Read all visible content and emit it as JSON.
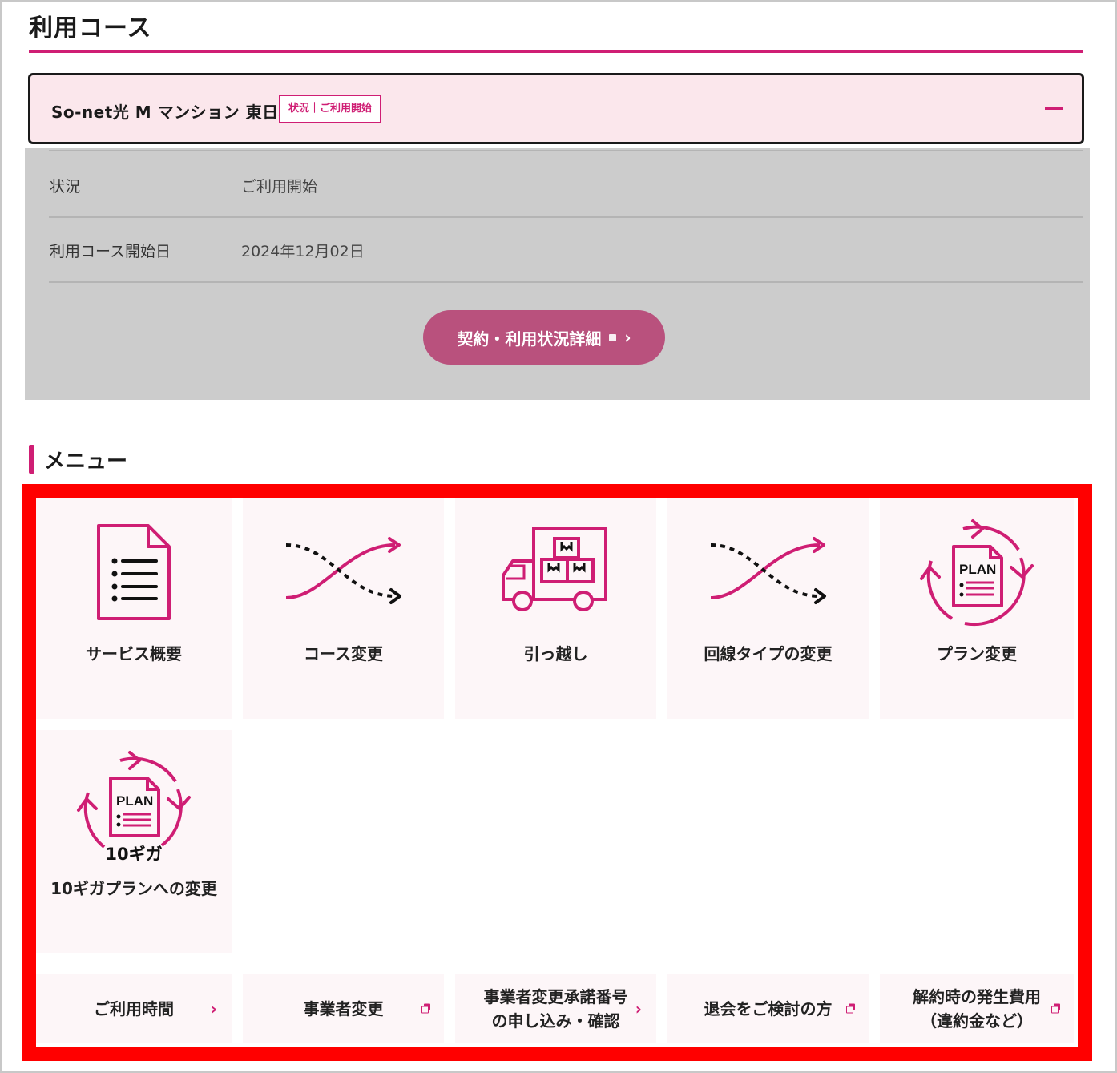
{
  "page_title": "利用コース",
  "course": {
    "name": "So-net光 M マンション 東日本",
    "status_badge": "状況｜ご利用開始",
    "details": [
      {
        "label": "状況",
        "value": "ご利用開始"
      },
      {
        "label": "利用コース開始日",
        "value": "2024年12月02日"
      }
    ],
    "detail_button": "契約・利用状況詳細",
    "detail_button_chevron": "›"
  },
  "menu": {
    "title": "メニュー",
    "tiles": [
      {
        "label": "サービス概要",
        "icon": "document-list-icon"
      },
      {
        "label": "コース変更",
        "icon": "crossing-arrows-icon"
      },
      {
        "label": "引っ越し",
        "icon": "moving-truck-icon"
      },
      {
        "label": "回線タイプの変更",
        "icon": "crossing-arrows-icon"
      },
      {
        "label": "プラン変更",
        "icon": "plan-cycle-icon",
        "icon_text": "PLAN"
      },
      {
        "label": "10ギガプランへの変更",
        "icon": "plan-cycle-10g-icon",
        "icon_text": "PLAN",
        "icon_sub": "10ギガ"
      }
    ],
    "links": [
      {
        "label": "ご利用時間",
        "indicator": "›",
        "type": "chevron"
      },
      {
        "label": "事業者変更",
        "type": "external"
      },
      {
        "label": "事業者変更承諾番号\nの申し込み・確認",
        "indicator": "›",
        "type": "chevron"
      },
      {
        "label": "退会をご検討の方",
        "type": "external"
      },
      {
        "label": "解約時の発生費用\n（違約金など）",
        "type": "external"
      }
    ]
  },
  "colors": {
    "accent": "#cf1e74",
    "button": "#b9517d",
    "highlight_border": "#ff0000",
    "details_bg": "#cccccc",
    "header_bg": "#fbe7ec"
  }
}
